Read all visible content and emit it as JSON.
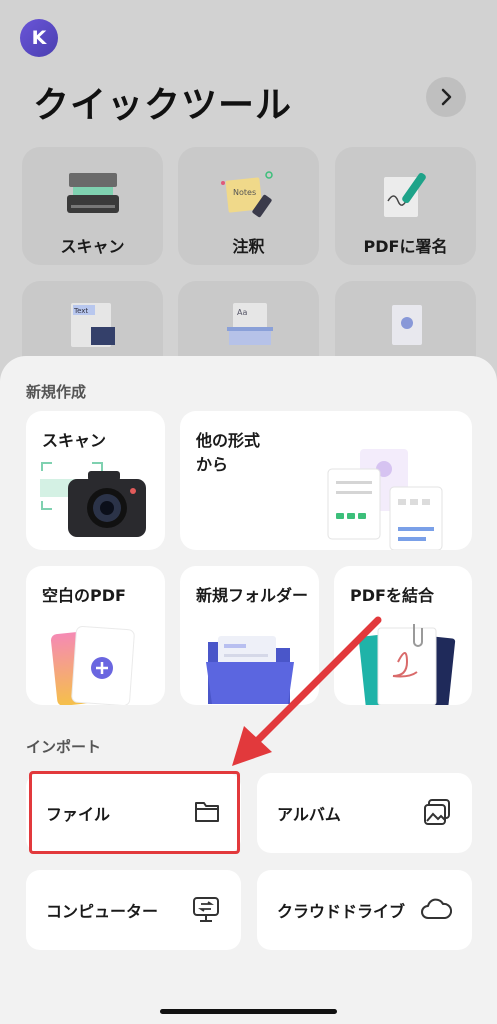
{
  "avatar": {
    "initial": "K"
  },
  "header": {
    "title": "クイックツール"
  },
  "tools": [
    {
      "label": "スキャン",
      "icon": "scanner-icon"
    },
    {
      "label": "注釈",
      "icon": "notes-icon"
    },
    {
      "label": "PDFに署名",
      "icon": "signature-icon"
    }
  ],
  "sheet": {
    "new_section": "新規作成",
    "new_cards": {
      "scan": "スキャン",
      "other_format": "他の形式\nから",
      "blank_pdf": "空白のPDF",
      "new_folder": "新規フォルダー",
      "merge_pdf": "PDFを結合"
    },
    "import_section": "インポート",
    "import_items": {
      "file": "ファイル",
      "album": "アルバム",
      "computer": "コンピューター",
      "cloud": "クラウドドライブ"
    }
  },
  "colors": {
    "highlight": "#e2393c",
    "accent": "#5b5bd6"
  }
}
